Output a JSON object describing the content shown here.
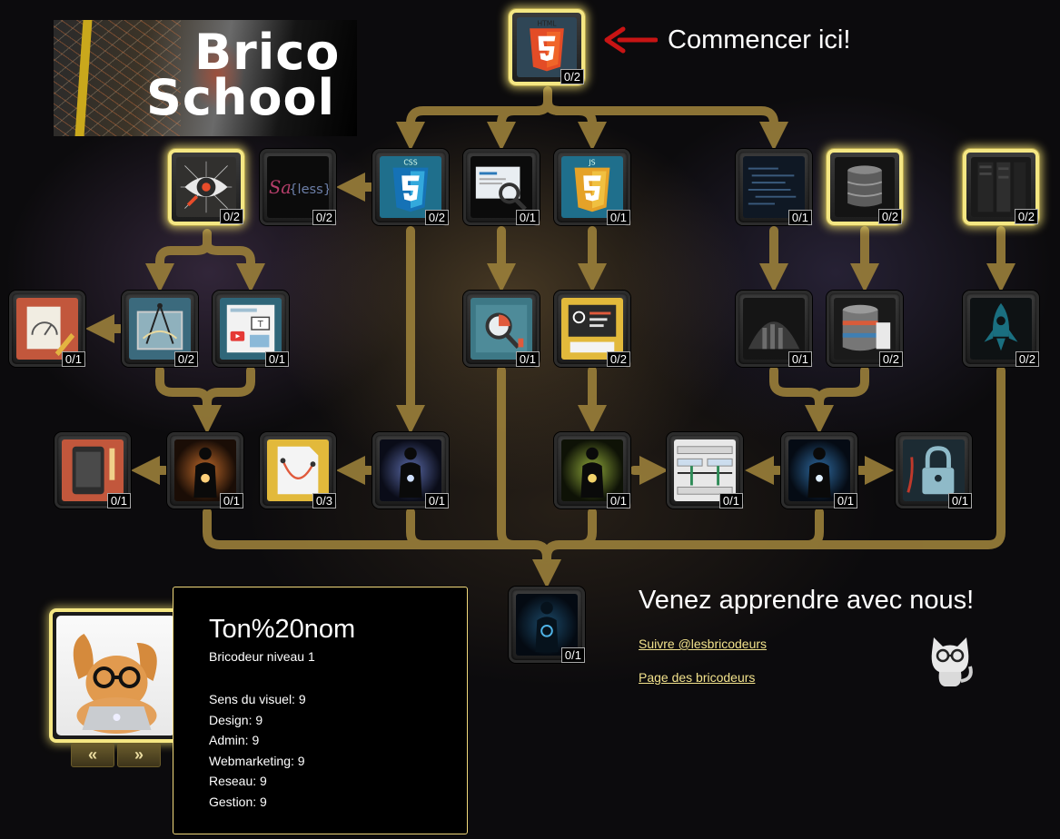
{
  "logo": {
    "line1": "Brico",
    "line2": "School"
  },
  "start_label": "Commencer ici!",
  "nodes": [
    {
      "id": "html",
      "icon": "html5-icon",
      "count": "0/2",
      "lit": true
    },
    {
      "id": "design",
      "icon": "eye-design-icon",
      "count": "0/2",
      "lit": true
    },
    {
      "id": "sass",
      "icon": "sass-less-icon",
      "count": "0/2",
      "lit": false
    },
    {
      "id": "css",
      "icon": "css3-icon",
      "count": "0/2",
      "lit": false
    },
    {
      "id": "seo",
      "icon": "seo-magnifier-icon",
      "count": "0/1",
      "lit": false
    },
    {
      "id": "js",
      "icon": "js-icon",
      "count": "0/1",
      "lit": false
    },
    {
      "id": "code",
      "icon": "code-screen-icon",
      "count": "0/1",
      "lit": false
    },
    {
      "id": "database",
      "icon": "database-icon",
      "count": "0/2",
      "lit": true
    },
    {
      "id": "server",
      "icon": "server-rack-icon",
      "count": "0/2",
      "lit": true
    },
    {
      "id": "pencil",
      "icon": "pencil-tools-icon",
      "count": "0/1",
      "lit": false
    },
    {
      "id": "compass",
      "icon": "compass-drawing-icon",
      "count": "0/2",
      "lit": false
    },
    {
      "id": "layout",
      "icon": "layout-media-icon",
      "count": "0/1",
      "lit": false
    },
    {
      "id": "analytics",
      "icon": "analytics-icon",
      "count": "0/1",
      "lit": false
    },
    {
      "id": "dev",
      "icon": "dev-settings-icon",
      "count": "0/2",
      "lit": false
    },
    {
      "id": "cloud",
      "icon": "datacenter-icon",
      "count": "0/1",
      "lit": false
    },
    {
      "id": "dbstack",
      "icon": "database-stack-icon",
      "count": "0/2",
      "lit": false
    },
    {
      "id": "rocket",
      "icon": "rocket-icon",
      "count": "0/2",
      "lit": false
    },
    {
      "id": "tablet",
      "icon": "tablet-icon",
      "count": "0/1",
      "lit": false
    },
    {
      "id": "hero_a",
      "icon": "hero-orange-icon",
      "count": "0/1",
      "lit": false
    },
    {
      "id": "curve",
      "icon": "bezier-curve-icon",
      "count": "0/3",
      "lit": false
    },
    {
      "id": "hero_b",
      "icon": "hero-blue-icon",
      "count": "0/1",
      "lit": false
    },
    {
      "id": "hero_c",
      "icon": "hero-green-icon",
      "count": "0/1",
      "lit": false
    },
    {
      "id": "thread",
      "icon": "thread-diagram-icon",
      "count": "0/1",
      "lit": false
    },
    {
      "id": "hero_d",
      "icon": "hero-cyan-icon",
      "count": "0/1",
      "lit": false
    },
    {
      "id": "lock",
      "icon": "padlock-icon",
      "count": "0/1",
      "lit": false
    },
    {
      "id": "master",
      "icon": "hero-master-icon",
      "count": "0/1",
      "lit": false
    }
  ],
  "promo": {
    "title": "Venez apprendre avec nous!",
    "follow_link": "Suivre @lesbricodeurs",
    "page_link": "Page des bricodeurs",
    "cat_icon": "cat-glasses-icon"
  },
  "profile": {
    "avatar_icon": "rabbit-laptop-avatar",
    "prev_label": "«",
    "next_label": "»",
    "name": "Ton%20nom",
    "level": "Bricodeur niveau 1",
    "stats": [
      "Sens du visuel: 9",
      "Design: 9",
      "Admin: 9",
      "Webmarketing: 9",
      "Reseau: 9",
      "Gestion: 9"
    ]
  },
  "colors": {
    "path": "#9a7f3a",
    "glow": "#f5e783",
    "link": "#f2e28c"
  }
}
